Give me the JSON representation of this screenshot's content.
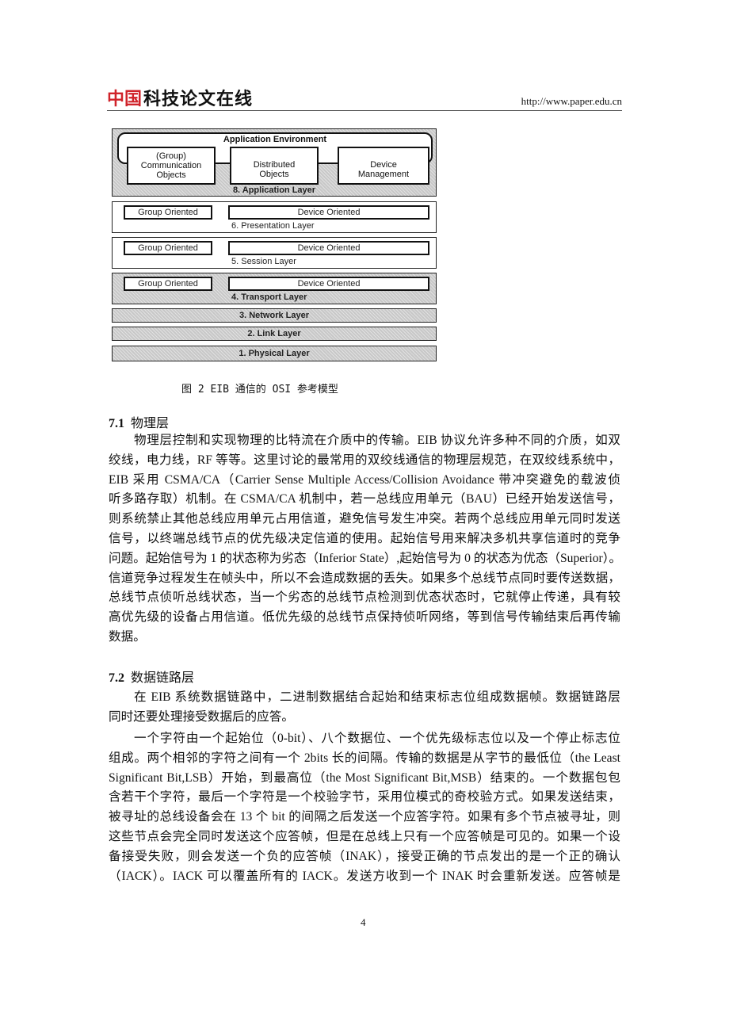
{
  "header": {
    "logo_red": "中国",
    "logo_black": "科技论文在线",
    "url": "http://www.paper.edu.cn"
  },
  "figure": {
    "application_environment": "Application Environment",
    "app_boxes": [
      {
        "lines": [
          "(Group)",
          "Communication",
          "Objects"
        ]
      },
      {
        "lines": [
          "Distributed",
          "Objects"
        ]
      },
      {
        "lines": [
          "Device",
          "Management"
        ]
      }
    ],
    "layers": [
      {
        "label": "8. Application Layer",
        "shaded": true
      },
      {
        "label": "6. Presentation Layer",
        "shaded": false,
        "group": "Group Oriented",
        "device": "Device Oriented"
      },
      {
        "label": "5. Session Layer",
        "shaded": false,
        "group": "Group Oriented",
        "device": "Device Oriented"
      },
      {
        "label": "4. Transport Layer",
        "shaded": true,
        "group": "Group Oriented",
        "device": "Device Oriented"
      },
      {
        "label": "3. Network Layer",
        "shaded": true
      },
      {
        "label": "2. Link Layer",
        "shaded": true
      },
      {
        "label": "1. Physical Layer",
        "shaded": true
      }
    ],
    "caption": "图 2 EIB 通信的 OSI 参考模型"
  },
  "sections": [
    {
      "number": "7.1",
      "title": "物理层",
      "lines": [
        "物理层控制和实现物理的比特流在介质中的传输。EIB 协议允许多种不同的介质，如双",
        "绞线，电力线，RF 等等。这里讨论的最常用的双绞线通信的物理层规范，在双绞线系统中，",
        "EIB 采用 CSMA/CA（Carrier Sense Multiple Access/Collision Avoidance 带冲突避免的载波侦",
        "听多路存取）机制。在 CSMA/CA 机制中，若一总线应用单元（BAU）已经开始发送信号，",
        "则系统禁止其他总线应用单元占用信道，避免信号发生冲突。若两个总线应用单元同时发送",
        "信号，以终端总线节点的优先级决定信道的使用。起始信号用来解决多机共享信道时的竞争",
        "问题。起始信号为 1 的状态称为劣态（Inferior State）,起始信号为 0 的状态为优态（Superior）。",
        "信道竞争过程发生在帧头中，所以不会造成数据的丢失。如果多个总线节点同时要传送数据，",
        "总线节点侦听总线状态，当一个劣态的总线节点检测到优态状态时，它就停止传递，具有较",
        "高优先级的设备占用信道。低优先级的总线节点保持侦听网络，等到信号传输结束后再传输",
        "数据。"
      ]
    },
    {
      "number": "7.2",
      "title": "数据链路层",
      "lines": [
        "在 EIB 系统数据链路中，二进制数据结合起始和结束标志位组成数据帧。数据链路层",
        "同时还要处理接受数据后的应答。"
      ],
      "lines2": [
        "一个字符由一个起始位（0-bit）、八个数据位、一个优先级标志位以及一个停止标志位",
        "组成。两个相邻的字符之间有一个 2bits 长的间隔。传输的数据是从字节的最低位（the Least",
        "Significant Bit,LSB）开始，到最高位（the Most Significant Bit,MSB）结束的。一个数据包包",
        "含若干个字符，最后一个字符是一个校验字节，采用位模式的奇校验方式。如果发送结束，",
        "被寻址的总线设备会在 13 个 bit 的间隔之后发送一个应答字符。如果有多个节点被寻址，则",
        "这些节点会完全同时发送这个应答帧，但是在总线上只有一个应答帧是可见的。如果一个设",
        "备接受失败，则会发送一个负的应答帧（INAK），接受正确的节点发出的是一个正的确认",
        "（IACK）。IACK 可以覆盖所有的 IACK。发送方收到一个 INAK 时会重新发送。应答帧是"
      ]
    }
  ],
  "page_number": "4"
}
